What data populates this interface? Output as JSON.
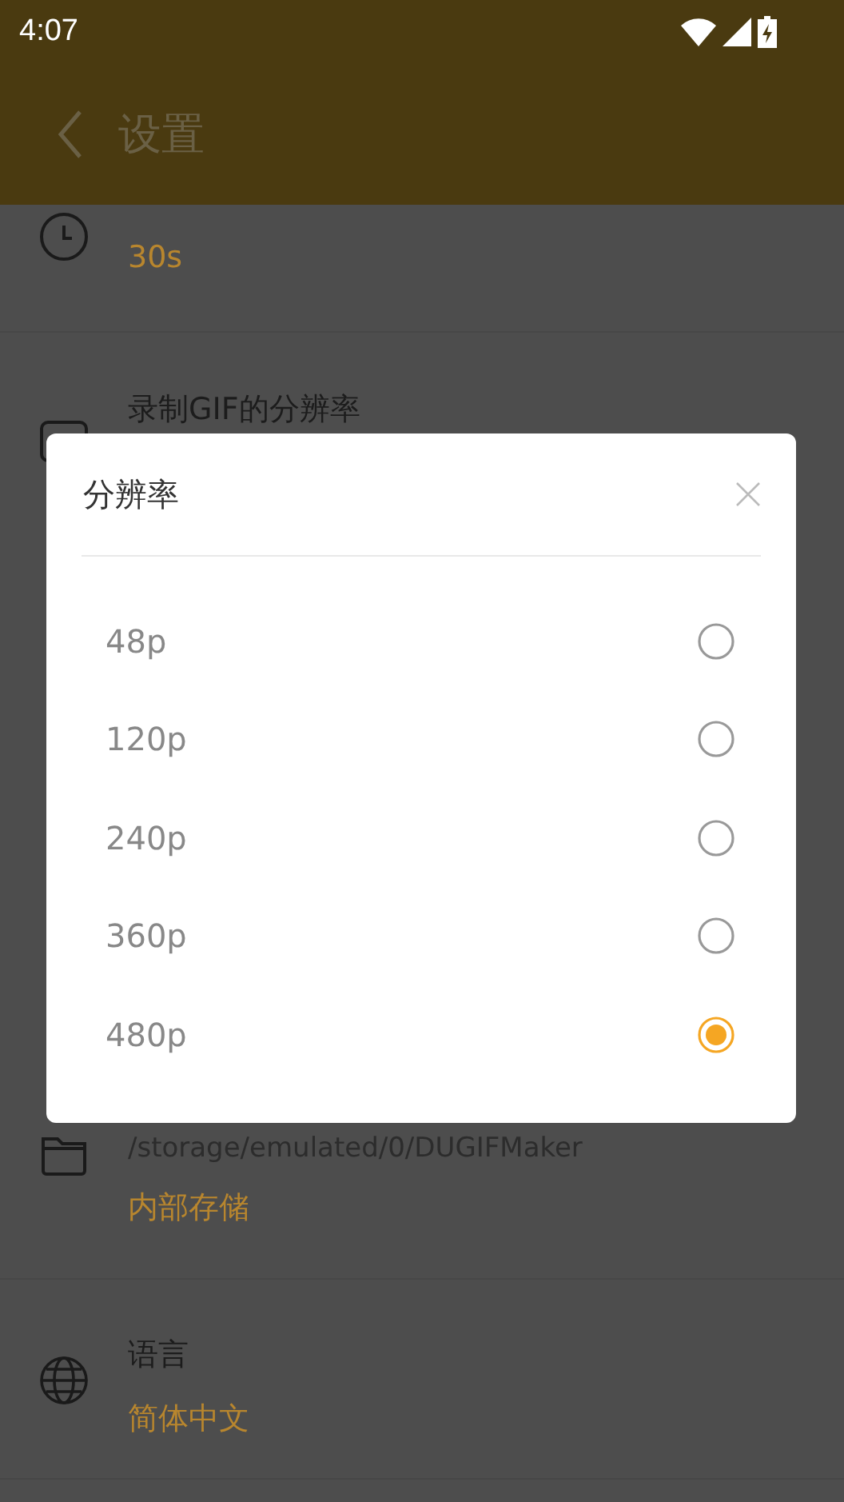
{
  "status_bar": {
    "time": "4:07"
  },
  "app_bar": {
    "title": "设置"
  },
  "settings": [
    {
      "kind": "clock",
      "value": "30s"
    },
    {
      "kind": "resolution",
      "title": "录制GIF的分辨率"
    },
    {
      "kind": "folder",
      "title": "/storage/emulated/0/DUGIFMaker",
      "value": "内部存储"
    },
    {
      "kind": "globe",
      "title": "语言",
      "value": "简体中文"
    }
  ],
  "dialog": {
    "title": "分辨率",
    "options": [
      {
        "label": "48p",
        "selected": false
      },
      {
        "label": "120p",
        "selected": false
      },
      {
        "label": "240p",
        "selected": false
      },
      {
        "label": "360p",
        "selected": false
      },
      {
        "label": "480p",
        "selected": true
      }
    ]
  }
}
